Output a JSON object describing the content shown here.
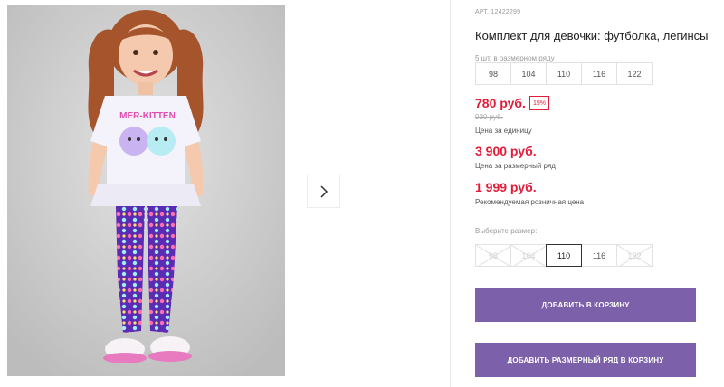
{
  "product": {
    "art_label": "АРТ. 12422299",
    "title": "Комплект для девочки: футболка, легинсы"
  },
  "size_row": {
    "note": "5 шт. в размерном ряду",
    "sizes": [
      "98",
      "104",
      "110",
      "116",
      "122"
    ]
  },
  "pricing": {
    "price": "780 руб.",
    "discount": "15%",
    "old_price": "920 руб.",
    "unit_note": "Цена за единицу",
    "row_price": "3 900 руб.",
    "row_note": "Цена за размерный ряд",
    "rrp": "1 999 руб.",
    "rrp_note": "Рекомендуемая розничная цена"
  },
  "size_select": {
    "label": "Выберите размер:",
    "options": [
      {
        "label": "98",
        "state": "disabled"
      },
      {
        "label": "104",
        "state": "disabled"
      },
      {
        "label": "110",
        "state": "selected"
      },
      {
        "label": "116",
        "state": "available"
      },
      {
        "label": "122",
        "state": "disabled"
      }
    ]
  },
  "actions": {
    "add_to_cart": "ДОБАВИТЬ В КОРЗИНУ",
    "add_row_to_cart": "ДОБАВИТЬ РАЗМЕРНЫЙ РЯД В КОРЗИНУ"
  },
  "print_text": "MER-KITTEN",
  "icons": {
    "next": "chevron-right-icon"
  },
  "colors": {
    "accent": "#7c60a9",
    "price": "#e11d3a",
    "legging": "#5b2bb3"
  }
}
